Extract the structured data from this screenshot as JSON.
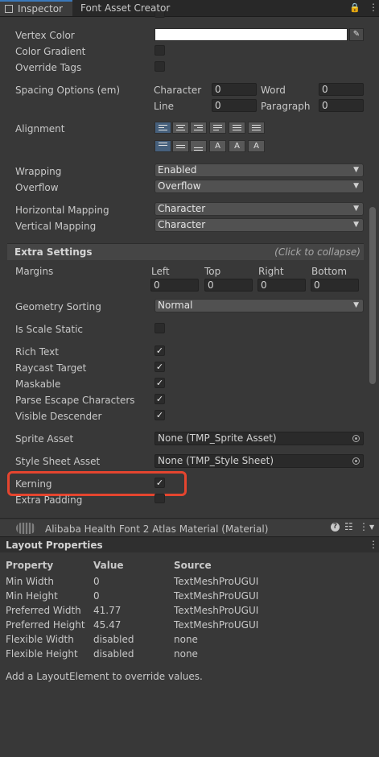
{
  "tabs": {
    "inspector": "Inspector",
    "font_asset_creator": "Font Asset Creator"
  },
  "rows": {
    "vertex_color": "Vertex Color",
    "color_gradient": "Color Gradient",
    "override_tags": "Override Tags",
    "spacing_options": "Spacing Options (em)",
    "alignment": "Alignment",
    "wrapping": "Wrapping",
    "overflow": "Overflow",
    "horizontal_mapping": "Horizontal Mapping",
    "vertical_mapping": "Vertical Mapping"
  },
  "spacing": {
    "character_label": "Character",
    "character_value": "0",
    "word_label": "Word",
    "word_value": "0",
    "line_label": "Line",
    "line_value": "0",
    "paragraph_label": "Paragraph",
    "paragraph_value": "0"
  },
  "dropdowns": {
    "wrapping": "Enabled",
    "overflow": "Overflow",
    "horizontal_mapping": "Character",
    "vertical_mapping": "Character",
    "geometry_sorting": "Normal"
  },
  "extra_settings": {
    "title": "Extra Settings",
    "collapse_hint": "(Click to collapse)",
    "margins_label": "Margins",
    "left_label": "Left",
    "left_value": "0",
    "top_label": "Top",
    "top_value": "0",
    "right_label": "Right",
    "right_value": "0",
    "bottom_label": "Bottom",
    "bottom_value": "0",
    "geometry_sorting": "Geometry Sorting",
    "is_scale_static": "Is Scale Static",
    "rich_text": "Rich Text",
    "raycast_target": "Raycast Target",
    "maskable": "Maskable",
    "parse_escape": "Parse Escape Characters",
    "visible_descender": "Visible Descender",
    "sprite_asset": "Sprite Asset",
    "sprite_asset_value": "None (TMP_Sprite Asset)",
    "style_sheet_asset": "Style Sheet Asset",
    "style_sheet_value": "None (TMP_Style Sheet)",
    "kerning": "Kerning",
    "extra_padding": "Extra Padding"
  },
  "material": {
    "title": "Alibaba Health Font 2 Atlas Material (Material)"
  },
  "layout": {
    "title": "Layout Properties",
    "headers": [
      "Property",
      "Value",
      "Source"
    ],
    "rows": [
      [
        "Min Width",
        "0",
        "TextMeshProUGUI"
      ],
      [
        "Min Height",
        "0",
        "TextMeshProUGUI"
      ],
      [
        "Preferred Width",
        "41.77",
        "TextMeshProUGUI"
      ],
      [
        "Preferred Height",
        "45.47",
        "TextMeshProUGUI"
      ],
      [
        "Flexible Width",
        "disabled",
        "none"
      ],
      [
        "Flexible Height",
        "disabled",
        "none"
      ]
    ],
    "hint": "Add a LayoutElement to override values."
  },
  "colors": {
    "highlight": "#e5452f",
    "accent": "#3a79bb"
  }
}
